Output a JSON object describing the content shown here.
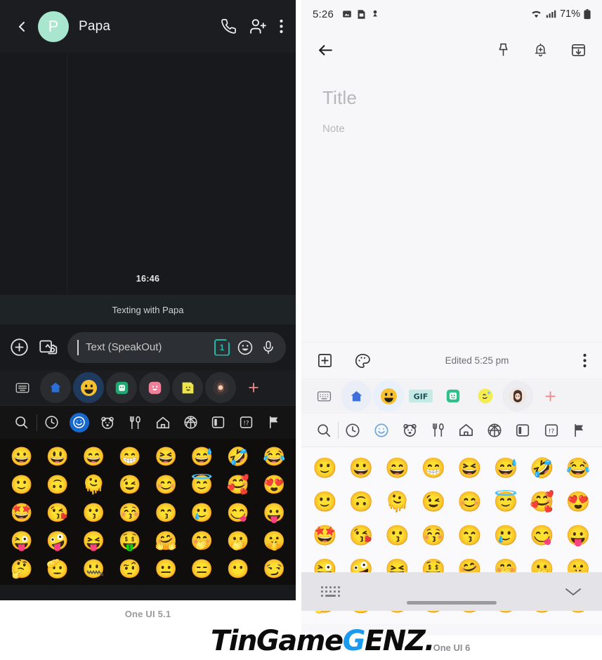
{
  "left_panel": {
    "caption": "One UI 5.1",
    "header": {
      "back_icon": "chevron-left-icon",
      "avatar_initial": "P",
      "contact_name": "Papa",
      "call_icon": "phone-icon",
      "add_person_icon": "person-add-icon",
      "overflow_icon": "more-vertical-icon"
    },
    "conversation": {
      "timestamp": "16:46",
      "banner": "Texting with Papa"
    },
    "composer": {
      "plus_icon": "plus-circle-icon",
      "gallery_icon": "image-camera-icon",
      "placeholder": "Text (SpeakOut)",
      "sim_label": "1",
      "emoji_icon": "smiley-icon",
      "mic_icon": "microphone-icon"
    },
    "suggestion_bar": [
      {
        "name": "keyboard-toggle",
        "glyph": "⌨",
        "style": "flat"
      },
      {
        "name": "home-sticker",
        "glyph": "⌂",
        "style": "circle"
      },
      {
        "name": "emoji-tab",
        "glyph": "😀",
        "style": "active"
      },
      {
        "name": "gif-tab",
        "glyph": "📷",
        "style": "circle"
      },
      {
        "name": "sticker-tab",
        "glyph": "😊",
        "style": "circle"
      },
      {
        "name": "bitmoji-tab",
        "glyph": "📝",
        "style": "circle"
      },
      {
        "name": "avatar-tab",
        "glyph": "👩",
        "style": "circle"
      },
      {
        "name": "add-tab",
        "glyph": "+",
        "style": "plus"
      }
    ],
    "categories": [
      "search-icon",
      "clock-recents-icon",
      "smiley-faces-icon",
      "animals-icon",
      "food-icon",
      "travel-home-icon",
      "activities-ball-icon",
      "objects-icon",
      "symbols-icon",
      "flags-icon"
    ],
    "active_category": "smiley-faces-icon",
    "emoji_grid": [
      "😀",
      "😃",
      "😄",
      "😁",
      "😆",
      "😅",
      "🤣",
      "😂",
      "🙂",
      "🙃",
      "🫠",
      "😉",
      "😊",
      "😇",
      "🥰",
      "😍",
      "🤩",
      "😘",
      "😗",
      "😚",
      "😙",
      "🥲",
      "😋",
      "😛",
      "😜",
      "🤪",
      "😝",
      "🤑",
      "🤗",
      "🤭",
      "🫢",
      "🤫",
      "🤔",
      "🫡",
      "🤐",
      "🤨",
      "😐",
      "😑",
      "😶",
      "😏"
    ]
  },
  "right_panel": {
    "caption": "One UI 6",
    "status_bar": {
      "time": "5:26",
      "icons": [
        "photo-icon",
        "sim-card-icon",
        "download-icon"
      ],
      "wifi_icon": "wifi-icon",
      "signal_icon": "cellular-signal-icon",
      "battery_percent": "71%",
      "battery_icon": "battery-icon"
    },
    "header": {
      "back_icon": "arrow-left-icon",
      "pin_icon": "pin-icon",
      "reminder_icon": "bell-add-icon",
      "save_icon": "save-box-icon"
    },
    "note": {
      "title_placeholder": "Title",
      "body_placeholder": "Note"
    },
    "note_toolbar": {
      "add_icon": "plus-box-icon",
      "palette_icon": "palette-icon",
      "edited_label": "Edited 5:25 pm",
      "overflow_icon": "more-vertical-icon"
    },
    "suggestion_bar": [
      {
        "name": "keyboard-toggle",
        "glyph": "⌨",
        "style": "flat"
      },
      {
        "name": "home-sticker",
        "glyph": "⌂",
        "style": "halo"
      },
      {
        "name": "emoji-tab",
        "glyph": "😀",
        "style": "active"
      },
      {
        "name": "gif-tab",
        "glyph": "GIF",
        "style": "gif"
      },
      {
        "name": "sticker-tab",
        "glyph": "😊",
        "style": "sticker"
      },
      {
        "name": "bitmoji-tab",
        "glyph": "😜",
        "style": "bitmoji"
      },
      {
        "name": "avatar-tab",
        "glyph": "👩",
        "style": "avatar"
      },
      {
        "name": "add-tab",
        "glyph": "+",
        "style": "plus"
      }
    ],
    "categories": [
      "search-icon",
      "clock-recents-icon",
      "smiley-faces-icon",
      "animals-icon",
      "food-icon",
      "travel-home-icon",
      "activities-ball-icon",
      "objects-icon",
      "symbols-icon",
      "flags-icon"
    ],
    "active_category": "smiley-faces-icon",
    "emoji_grid": [
      "🙂",
      "😀",
      "😄",
      "😁",
      "😆",
      "😅",
      "🤣",
      "😂",
      "🙂",
      "🙃",
      "🫠",
      "😉",
      "😊",
      "😇",
      "🥰",
      "😍",
      "🤩",
      "😘",
      "😗",
      "😚",
      "😙",
      "🥲",
      "😋",
      "😛",
      "😜",
      "🤪",
      "😝",
      "🤑",
      "🤗",
      "🤭",
      "🫢",
      "🤫",
      "🤔",
      "🫡",
      "🤐",
      "🤨",
      "😐",
      "😑",
      "😶",
      "😏"
    ],
    "bottom_bar": {
      "keyboard_icon": "keyboard-dots-icon",
      "collapse_icon": "chevron-down-icon",
      "home_indicator": "home-indicator"
    }
  },
  "watermark": {
    "part1": "TinGame",
    "accent": "G",
    "part2": "ENZ."
  }
}
